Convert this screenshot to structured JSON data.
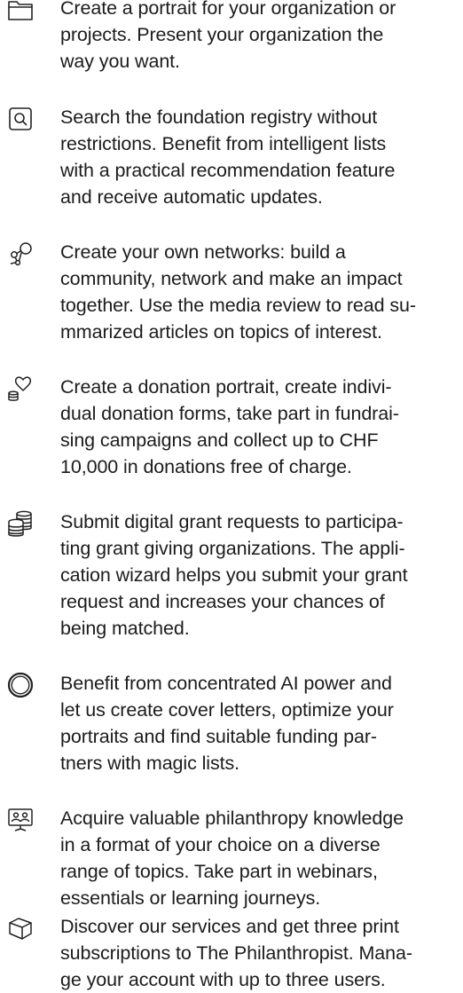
{
  "features": [
    {
      "icon": "folder-icon",
      "text": "Create a portrait for your organization or\nprojects. Present your organization the\nway you want."
    },
    {
      "icon": "search-icon",
      "text": "Search the foundation registry without\nrestrictions. Benefit from intelligent lists\nwith a practical recommendation feature\nand receive automatic updates."
    },
    {
      "icon": "network-icon",
      "text": "Create your own networks: build a\ncommunity, network and make an impact\ntogether. Use the media review to read su-\nmmarized articles on topics of interest."
    },
    {
      "icon": "donation-heart-icon",
      "text": "Create a donation portrait, create indivi-\ndual donation forms, take part in fundrai-\nsing campaigns and collect up to CHF\n10,000 in donations free of charge."
    },
    {
      "icon": "coin-stack-icon",
      "text": "Submit digital grant requests to participa-\nting grant giving organizations. The appli-\ncation wizard helps you submit your grant\nrequest and increases your chances of\nbeing matched."
    },
    {
      "icon": "ai-ring-icon",
      "text": "Benefit from concentrated AI power and\nlet us create cover letters, optimize your\nportraits and find suitable funding par-\ntners with magic lists."
    },
    {
      "icon": "presentation-icon",
      "text": "Acquire valuable philanthropy knowledge\nin a format of your choice on a diverse\nrange of topics. Take part in webinars,\nessentials or learning journeys."
    },
    {
      "icon": "package-icon",
      "text": "Discover our services and get three print\nsubscriptions to The Philanthropist. Mana-\nge your account with up to three users."
    }
  ]
}
